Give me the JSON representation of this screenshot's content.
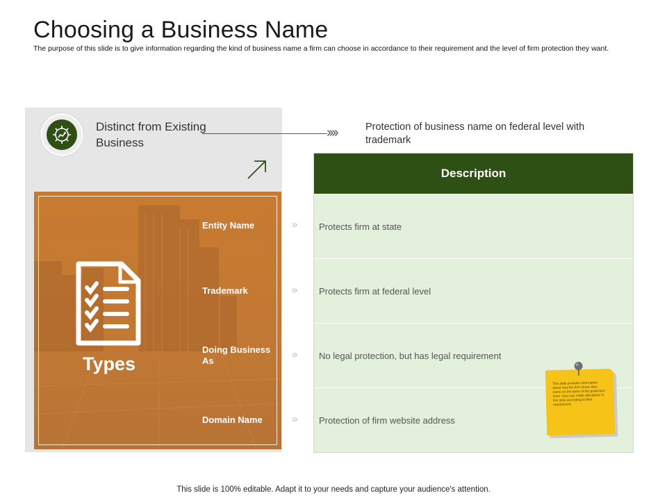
{
  "slide": {
    "title": "Choosing a Business Name",
    "subtitle": "The purpose of this slide is to give information regarding the kind of business name a firm can choose in accordance to their requirement and the level of firm protection they want.",
    "footer": "This slide is 100% editable. Adapt it to your needs and capture your audience's attention."
  },
  "header_row": {
    "icon": "gear-growth-icon",
    "distinct_label": "Distinct from Existing Business",
    "protection_label": "Protection of business name on federal level with trademark"
  },
  "types_panel": {
    "label": "Types",
    "icon": "checklist-document-icon",
    "items": [
      "Entity Name",
      "Trademark",
      "Doing Business As",
      "Domain Name"
    ]
  },
  "table": {
    "header": "Description",
    "rows": [
      "Protects firm at state",
      "Protects firm at federal level",
      "No legal protection, but has legal requirement",
      "Protection of firm website address"
    ]
  },
  "sticky_note": {
    "text": "This slide provides information about how the firm chose their name on the basis of the protection level. User can made alterations in this slide according to their requirement."
  },
  "colors": {
    "dark_green": "#2e5014",
    "light_green": "#e3f1dc",
    "orange": "#c27934",
    "panel_gray": "#e6e6e6",
    "sticky_yellow": "#f6c318"
  }
}
